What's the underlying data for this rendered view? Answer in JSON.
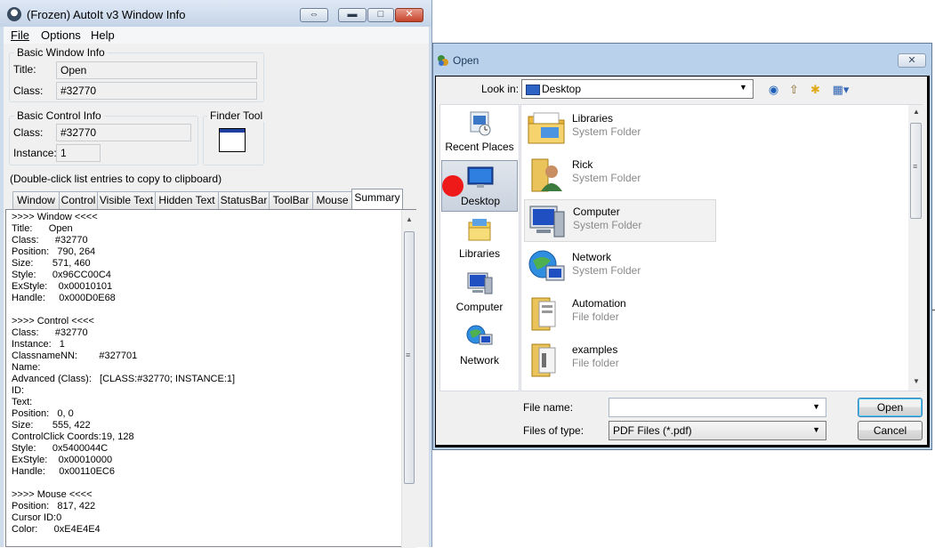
{
  "autoit": {
    "title": "(Frozen) AutoIt v3 Window Info",
    "menu": {
      "file": "File",
      "options": "Options",
      "help": "Help"
    },
    "basic_window": {
      "group_label": "Basic Window Info",
      "title_label": "Title:",
      "title_value": "Open",
      "class_label": "Class:",
      "class_value": "#32770"
    },
    "basic_control": {
      "group_label": "Basic Control Info",
      "class_label": "Class:",
      "class_value": "#32770",
      "instance_label": "Instance:",
      "instance_value": "1"
    },
    "finder_tool_label": "Finder Tool",
    "hint": "(Double-click list entries to copy to clipboard)",
    "tabs": [
      "Window",
      "Control",
      "Visible Text",
      "Hidden Text",
      "StatusBar",
      "ToolBar",
      "Mouse",
      "Summary"
    ],
    "active_tab": "Summary",
    "summary_text": ">>>> Window <<<<\nTitle:      Open\nClass:      #32770\nPosition:   790, 264\nSize:       571, 460\nStyle:      0x96CC00C4\nExStyle:    0x00010101\nHandle:     0x000D0E68\n\n>>>> Control <<<<\nClass:      #32770\nInstance:   1\nClassnameNN:        #327701\nName:\nAdvanced (Class):   [CLASS:#32770; INSTANCE:1]\nID:\nText:\nPosition:   0, 0\nSize:       555, 422\nControlClick Coords:19, 128\nStyle:      0x5400044C\nExStyle:    0x00010000\nHandle:     0x00110EC6\n\n>>>> Mouse <<<<\nPosition:   817, 422\nCursor ID:0\nColor:      0xE4E4E4"
  },
  "open_dialog": {
    "title": "Open",
    "look_in_label": "Look in:",
    "look_in_value": "Desktop",
    "places": [
      {
        "label": "Recent Places",
        "icon": "recent-places-icon"
      },
      {
        "label": "Desktop",
        "icon": "desktop-icon"
      },
      {
        "label": "Libraries",
        "icon": "libraries-icon"
      },
      {
        "label": "Computer",
        "icon": "computer-icon"
      },
      {
        "label": "Network",
        "icon": "network-icon"
      }
    ],
    "selected_place": "Desktop",
    "files": [
      {
        "name": "Libraries",
        "type": "System Folder",
        "icon": "libraries-folder-icon"
      },
      {
        "name": "Rick",
        "type": "System Folder",
        "icon": "user-folder-icon"
      },
      {
        "name": "Computer",
        "type": "System Folder",
        "icon": "computer-icon"
      },
      {
        "name": "Network",
        "type": "System Folder",
        "icon": "network-icon"
      },
      {
        "name": "Automation",
        "type": "File folder",
        "icon": "folder-icon"
      },
      {
        "name": "examples",
        "type": "File folder",
        "icon": "folder-icon"
      }
    ],
    "file_name_label": "File name:",
    "file_name_value": "",
    "file_type_label": "Files of type:",
    "file_type_value": "PDF Files  (*.pdf)",
    "open_button": "Open",
    "cancel_button": "Cancel"
  },
  "colors": {
    "titlebar": "#c4d4e8",
    "dialog_frame": "#b9d1ea",
    "close_button": "#c6432b",
    "cursor_dot": "#ee1a1a",
    "selection": "#c9d2de"
  }
}
